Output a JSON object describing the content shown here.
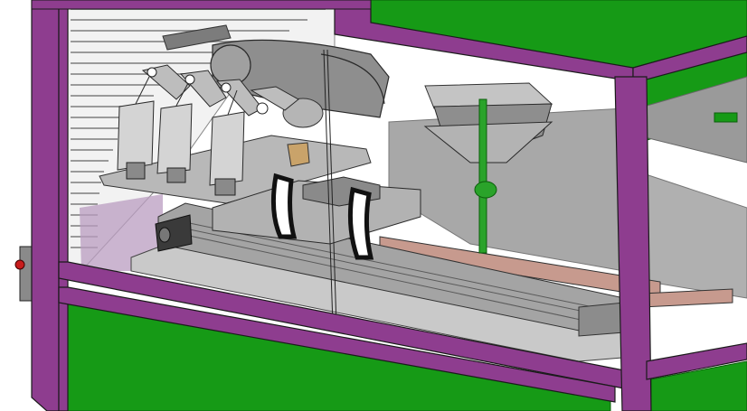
{
  "scene": {
    "subject": "",
    "colors": {
      "frame_purple": "#8e3d8f",
      "frame_outline": "#1b1b1b",
      "panel_green": "#169a16",
      "panel_green_dark": "#0f7d0f",
      "steel_gray": "#9c9c9c",
      "steel_dark": "#6e6e6e",
      "steel_light": "#c8c8c8",
      "base_plate": "#c9c9c9",
      "glass_tint": "#b99cc0",
      "shutter_white": "#f2f2f2",
      "belt_pink": "#c79a8e",
      "clamp_black": "#222222",
      "post_green": "#2aa32a",
      "button_red": "#c81c1c"
    }
  }
}
